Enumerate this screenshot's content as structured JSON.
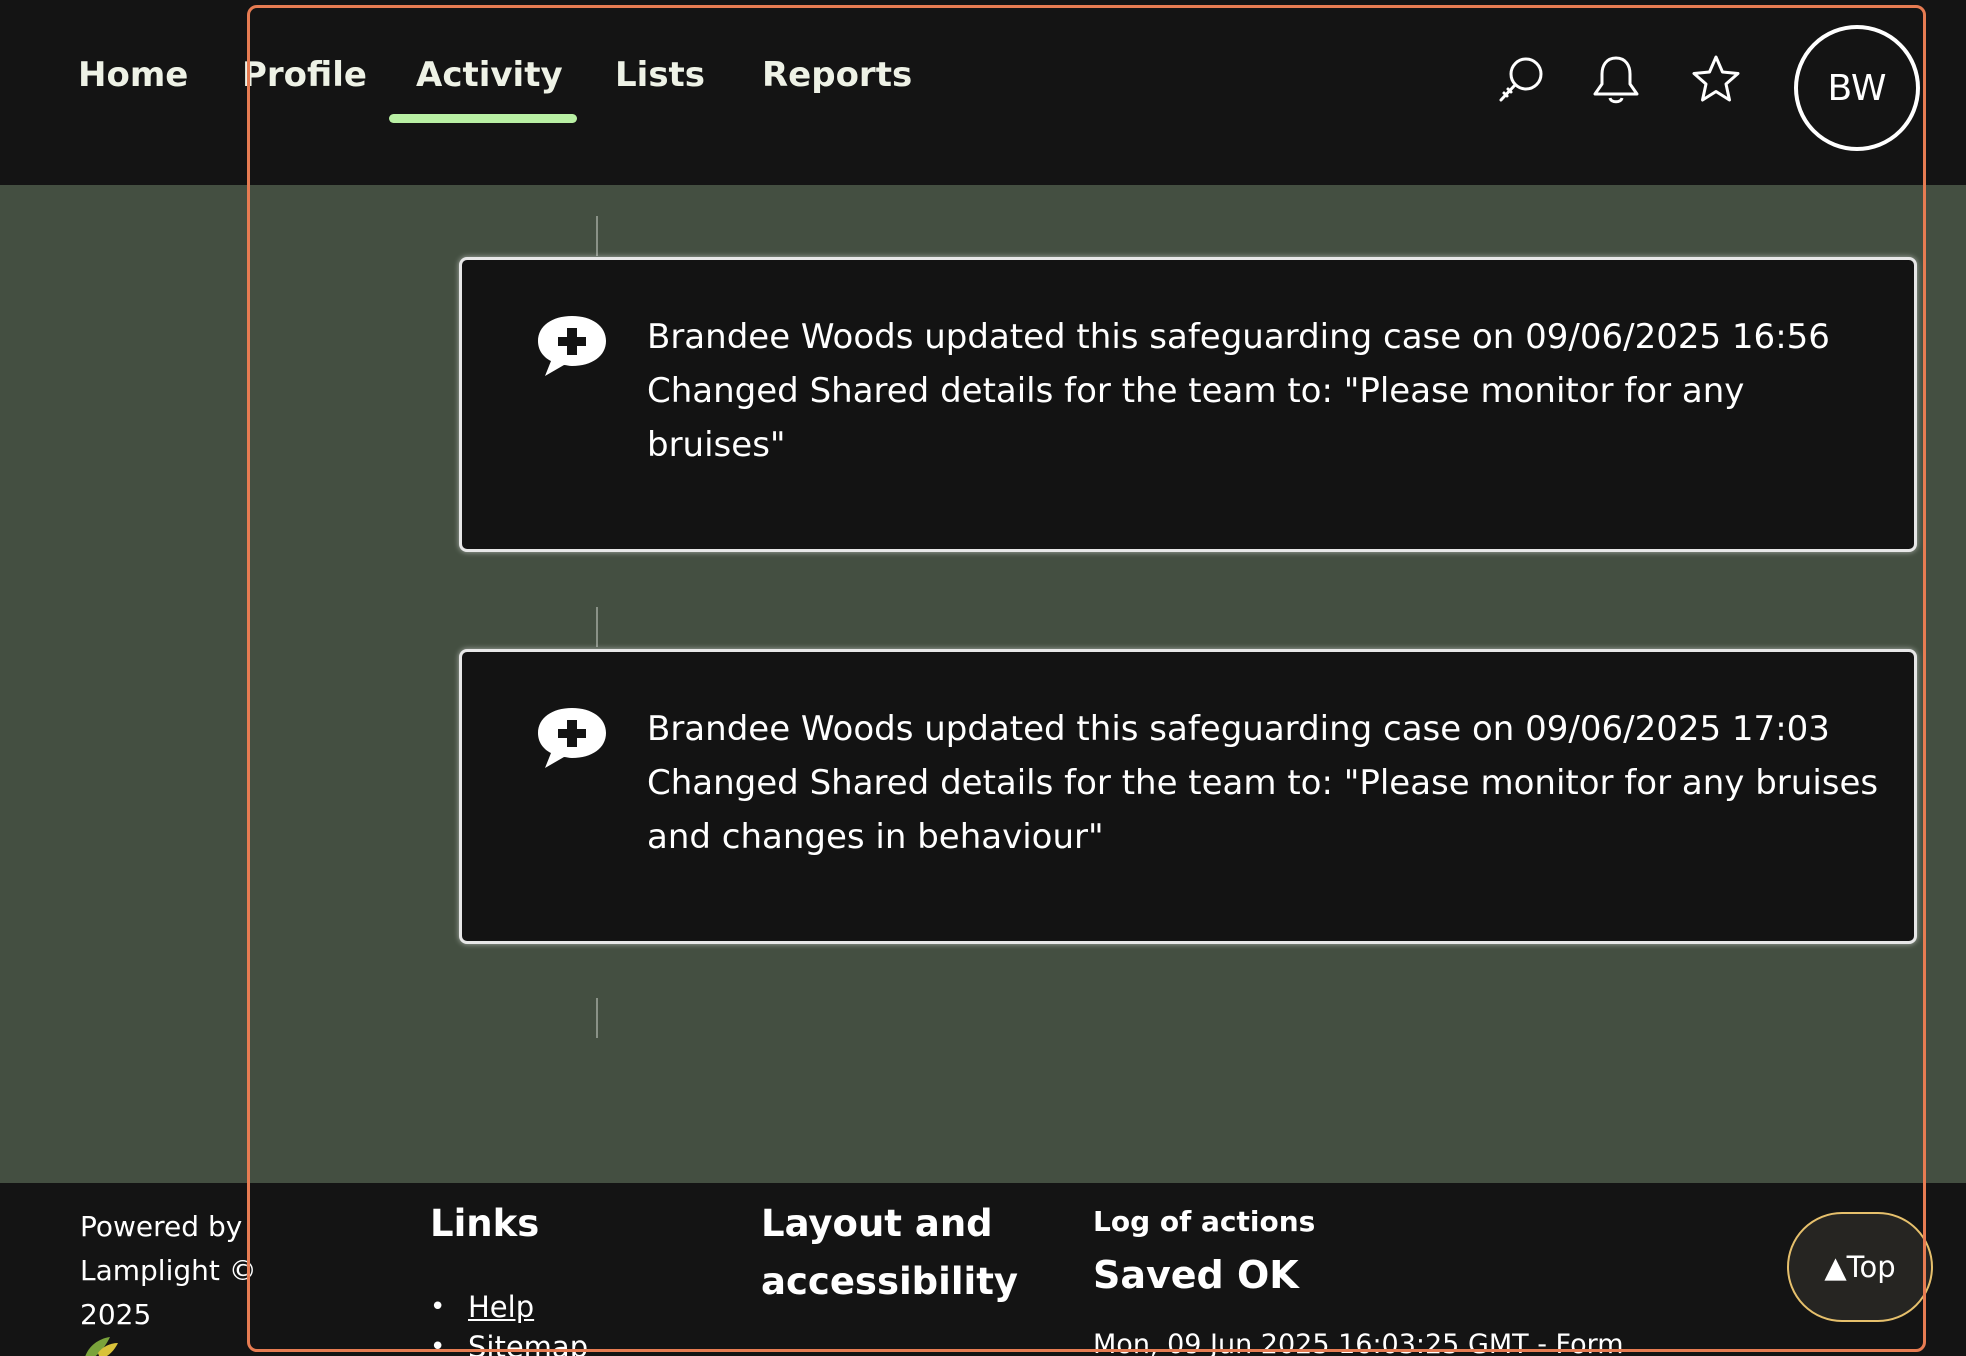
{
  "nav": {
    "items": [
      {
        "label": "Home"
      },
      {
        "label": "Profile"
      },
      {
        "label": "Activity"
      },
      {
        "label": "Lists"
      },
      {
        "label": "Reports"
      }
    ],
    "active": "Activity",
    "icons": [
      "search-icon",
      "bell-icon",
      "star-icon"
    ],
    "avatar_initials": "BW"
  },
  "activity": [
    {
      "icon": "speech-bubble-plus-icon",
      "summary": "Brandee Woods updated this safeguarding case on 09/06/2025 16:56",
      "detail": "Changed Shared details for the team to: \"Please monitor for any bruises\""
    },
    {
      "icon": "speech-bubble-plus-icon",
      "summary": "Brandee Woods updated this safeguarding case on 09/06/2025 17:03",
      "detail": "Changed Shared details for the team to: \"Please monitor for any bruises and changes in behaviour\""
    }
  ],
  "footer": {
    "powered_by": "Powered by Lamplight © 2025",
    "links_heading": "Links",
    "links": [
      "Help",
      "Sitemap"
    ],
    "layout_heading": "Layout and accessibility",
    "log_label": "Log of actions",
    "log_status": "Saved OK",
    "log_entry": "Mon, 09 Jun 2025 16:03:25 GMT - Form",
    "top_button": "▲Top"
  },
  "colors": {
    "accent": "#b9f0a4",
    "main_background": "#444f41",
    "focus_outline": "#e77c52",
    "top_button_border": "#e6c06c"
  }
}
